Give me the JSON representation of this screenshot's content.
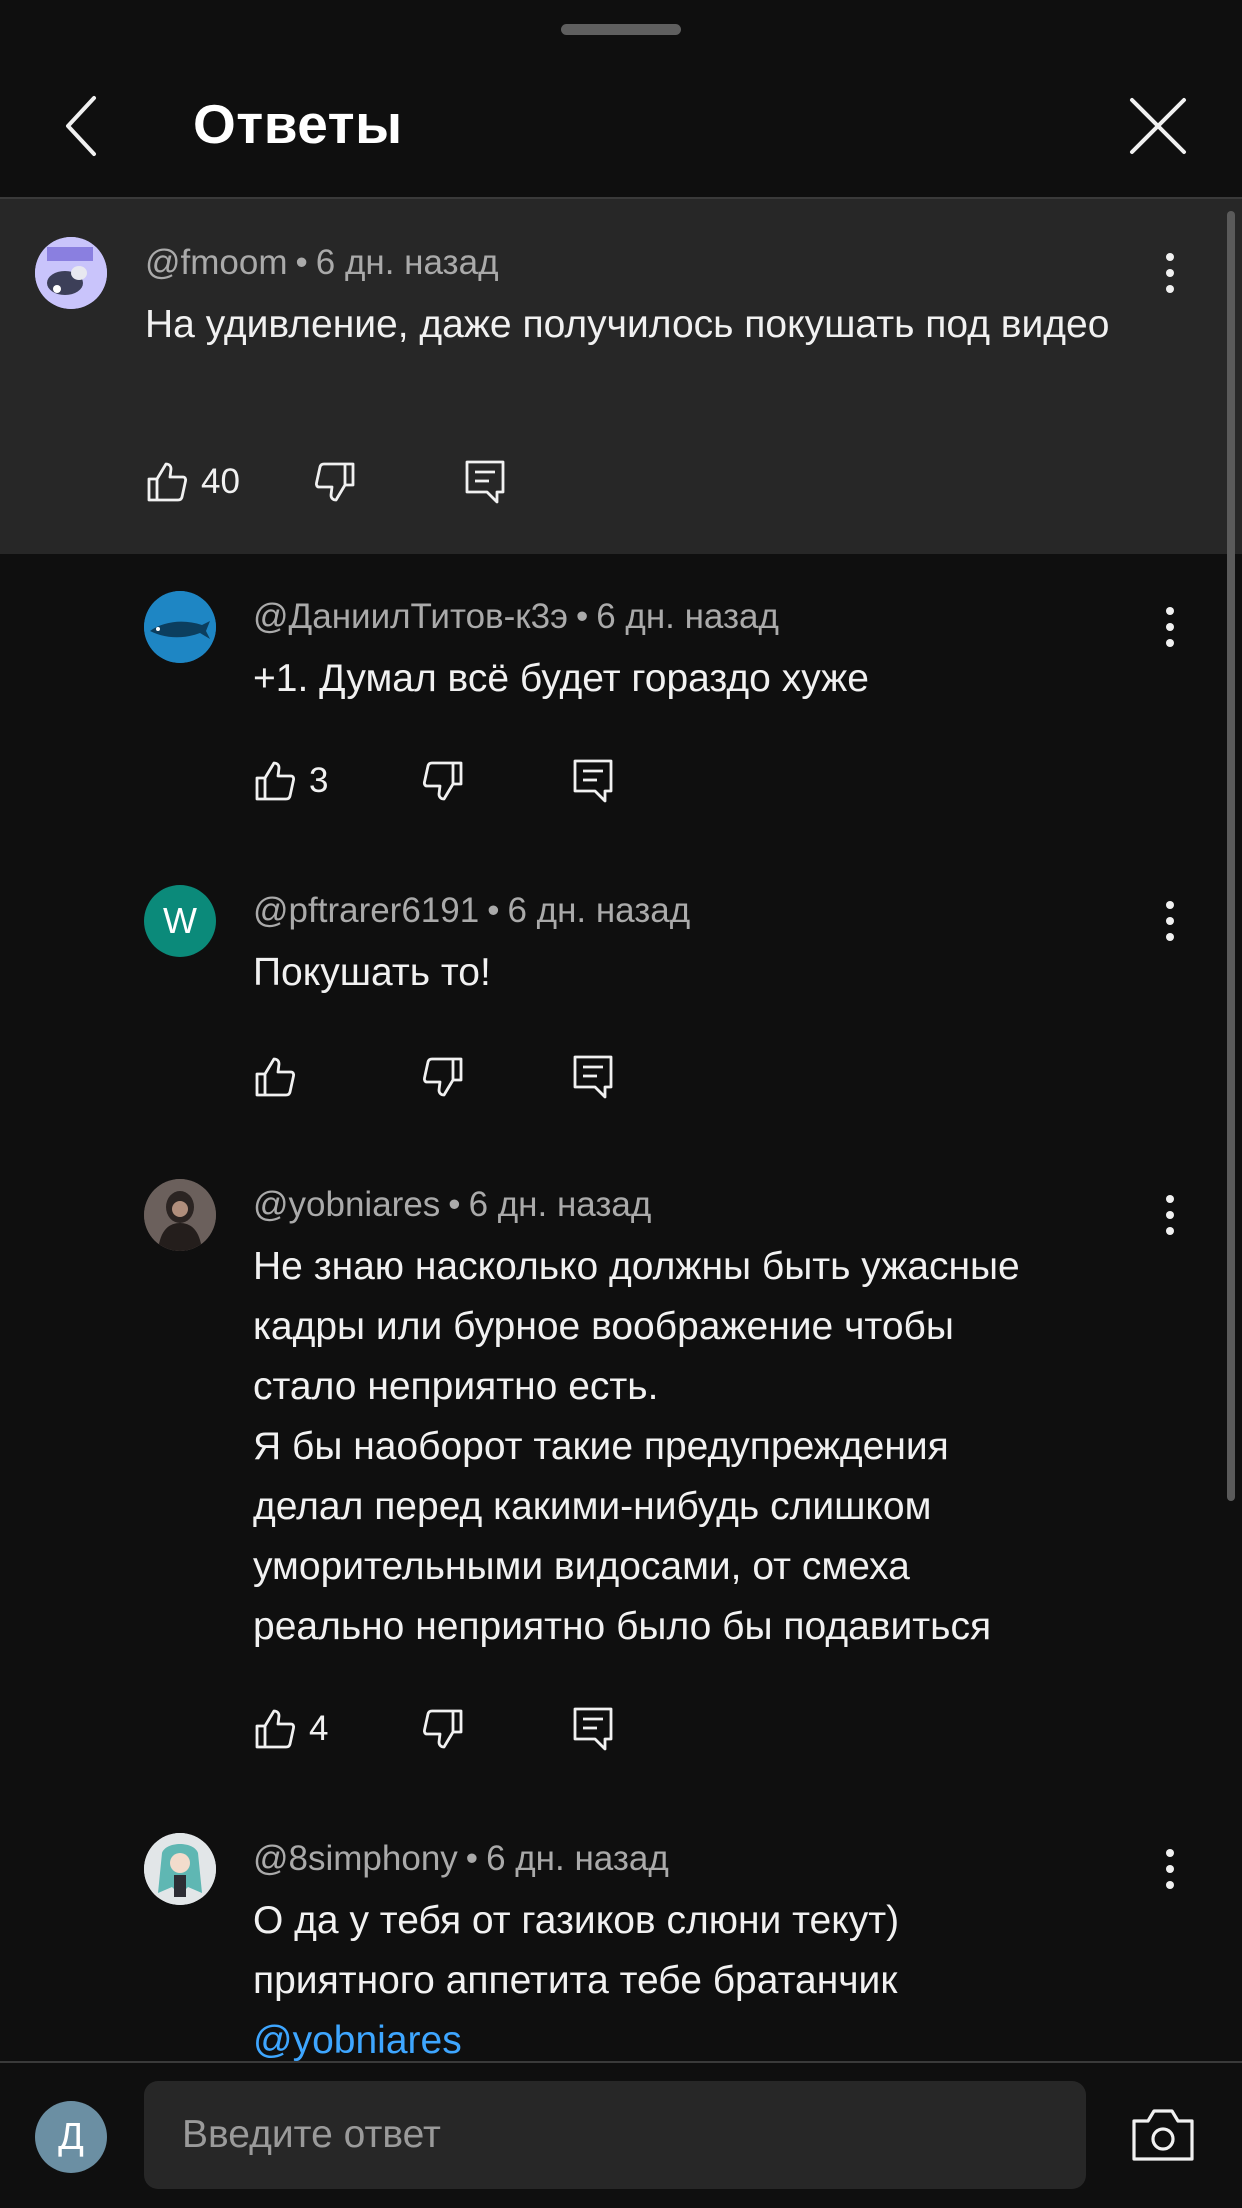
{
  "header": {
    "title": "Ответы"
  },
  "parent": {
    "author": "@fmoom",
    "time": "6 дн. назад",
    "text": "На удивление, даже получилось покушать под видео",
    "likes": "40"
  },
  "replies": [
    {
      "author": "@ДаниилТитов-к3э",
      "time": "6 дн. назад",
      "text": "+1. Думал всё будет гораздо хуже",
      "likes": "3"
    },
    {
      "author": "@pftrarer6191",
      "time": "6 дн. назад",
      "avatar_letter": "W",
      "avatar_color": "#0b8a7a",
      "text": "Покушать то!",
      "likes": ""
    },
    {
      "author": "@yobniares",
      "time": "6 дн. назад",
      "text_lines": [
        "Не знаю насколько должны быть ужасные",
        "кадры или бурное воображение чтобы",
        "стало неприятно есть.",
        "Я бы наоборот такие предупреждения",
        "делал перед какими-нибудь слишком",
        "уморительными видосами, от смеха",
        "реально неприятно было бы подавиться"
      ],
      "likes": "4"
    },
    {
      "author": "@8simphony",
      "time": "6 дн. назад",
      "text_lines": [
        "О да у тебя от газиков слюни текут)",
        "приятного аппетита тебе братанчик"
      ],
      "mention": "@yobniares"
    }
  ],
  "composer": {
    "avatar_letter": "Д",
    "placeholder": "Введите ответ"
  },
  "colors": {
    "background": "#0f0f0f",
    "highlight": "#272727",
    "mention": "#3ea6ff",
    "meta": "#aaaaaa"
  },
  "icons": [
    "back-arrow-icon",
    "close-icon",
    "more-vert-icon",
    "thumb-up-icon",
    "thumb-down-icon",
    "reply-icon",
    "camera-icon"
  ]
}
